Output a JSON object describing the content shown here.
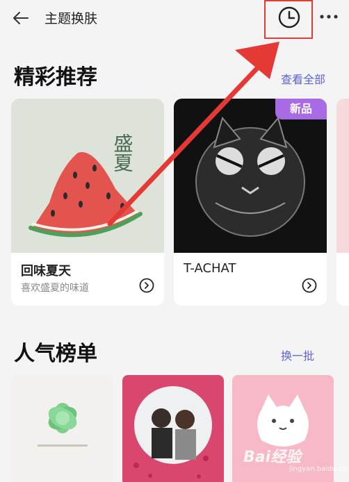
{
  "header": {
    "title": "主题换肤",
    "back_icon": "arrow-left-icon",
    "history_icon": "clock-icon",
    "more_icon": "more-dots-icon"
  },
  "featured": {
    "title": "精彩推荐",
    "link": "查看全部",
    "cards": [
      {
        "image_text": "盛夏",
        "name": "回味夏天",
        "subtitle": "喜欢盛夏的味道"
      },
      {
        "badge": "新品",
        "name": "T-ACHAT",
        "subtitle": ""
      }
    ]
  },
  "popular": {
    "title": "人气榜单",
    "link": "换一批"
  },
  "watermark": {
    "text": "Bai",
    "text2": "经验",
    "sub": "jingyan.baidu.com"
  },
  "colors": {
    "accent": "#5b63d6",
    "badge": "#a86be6",
    "highlight": "#e53935"
  }
}
